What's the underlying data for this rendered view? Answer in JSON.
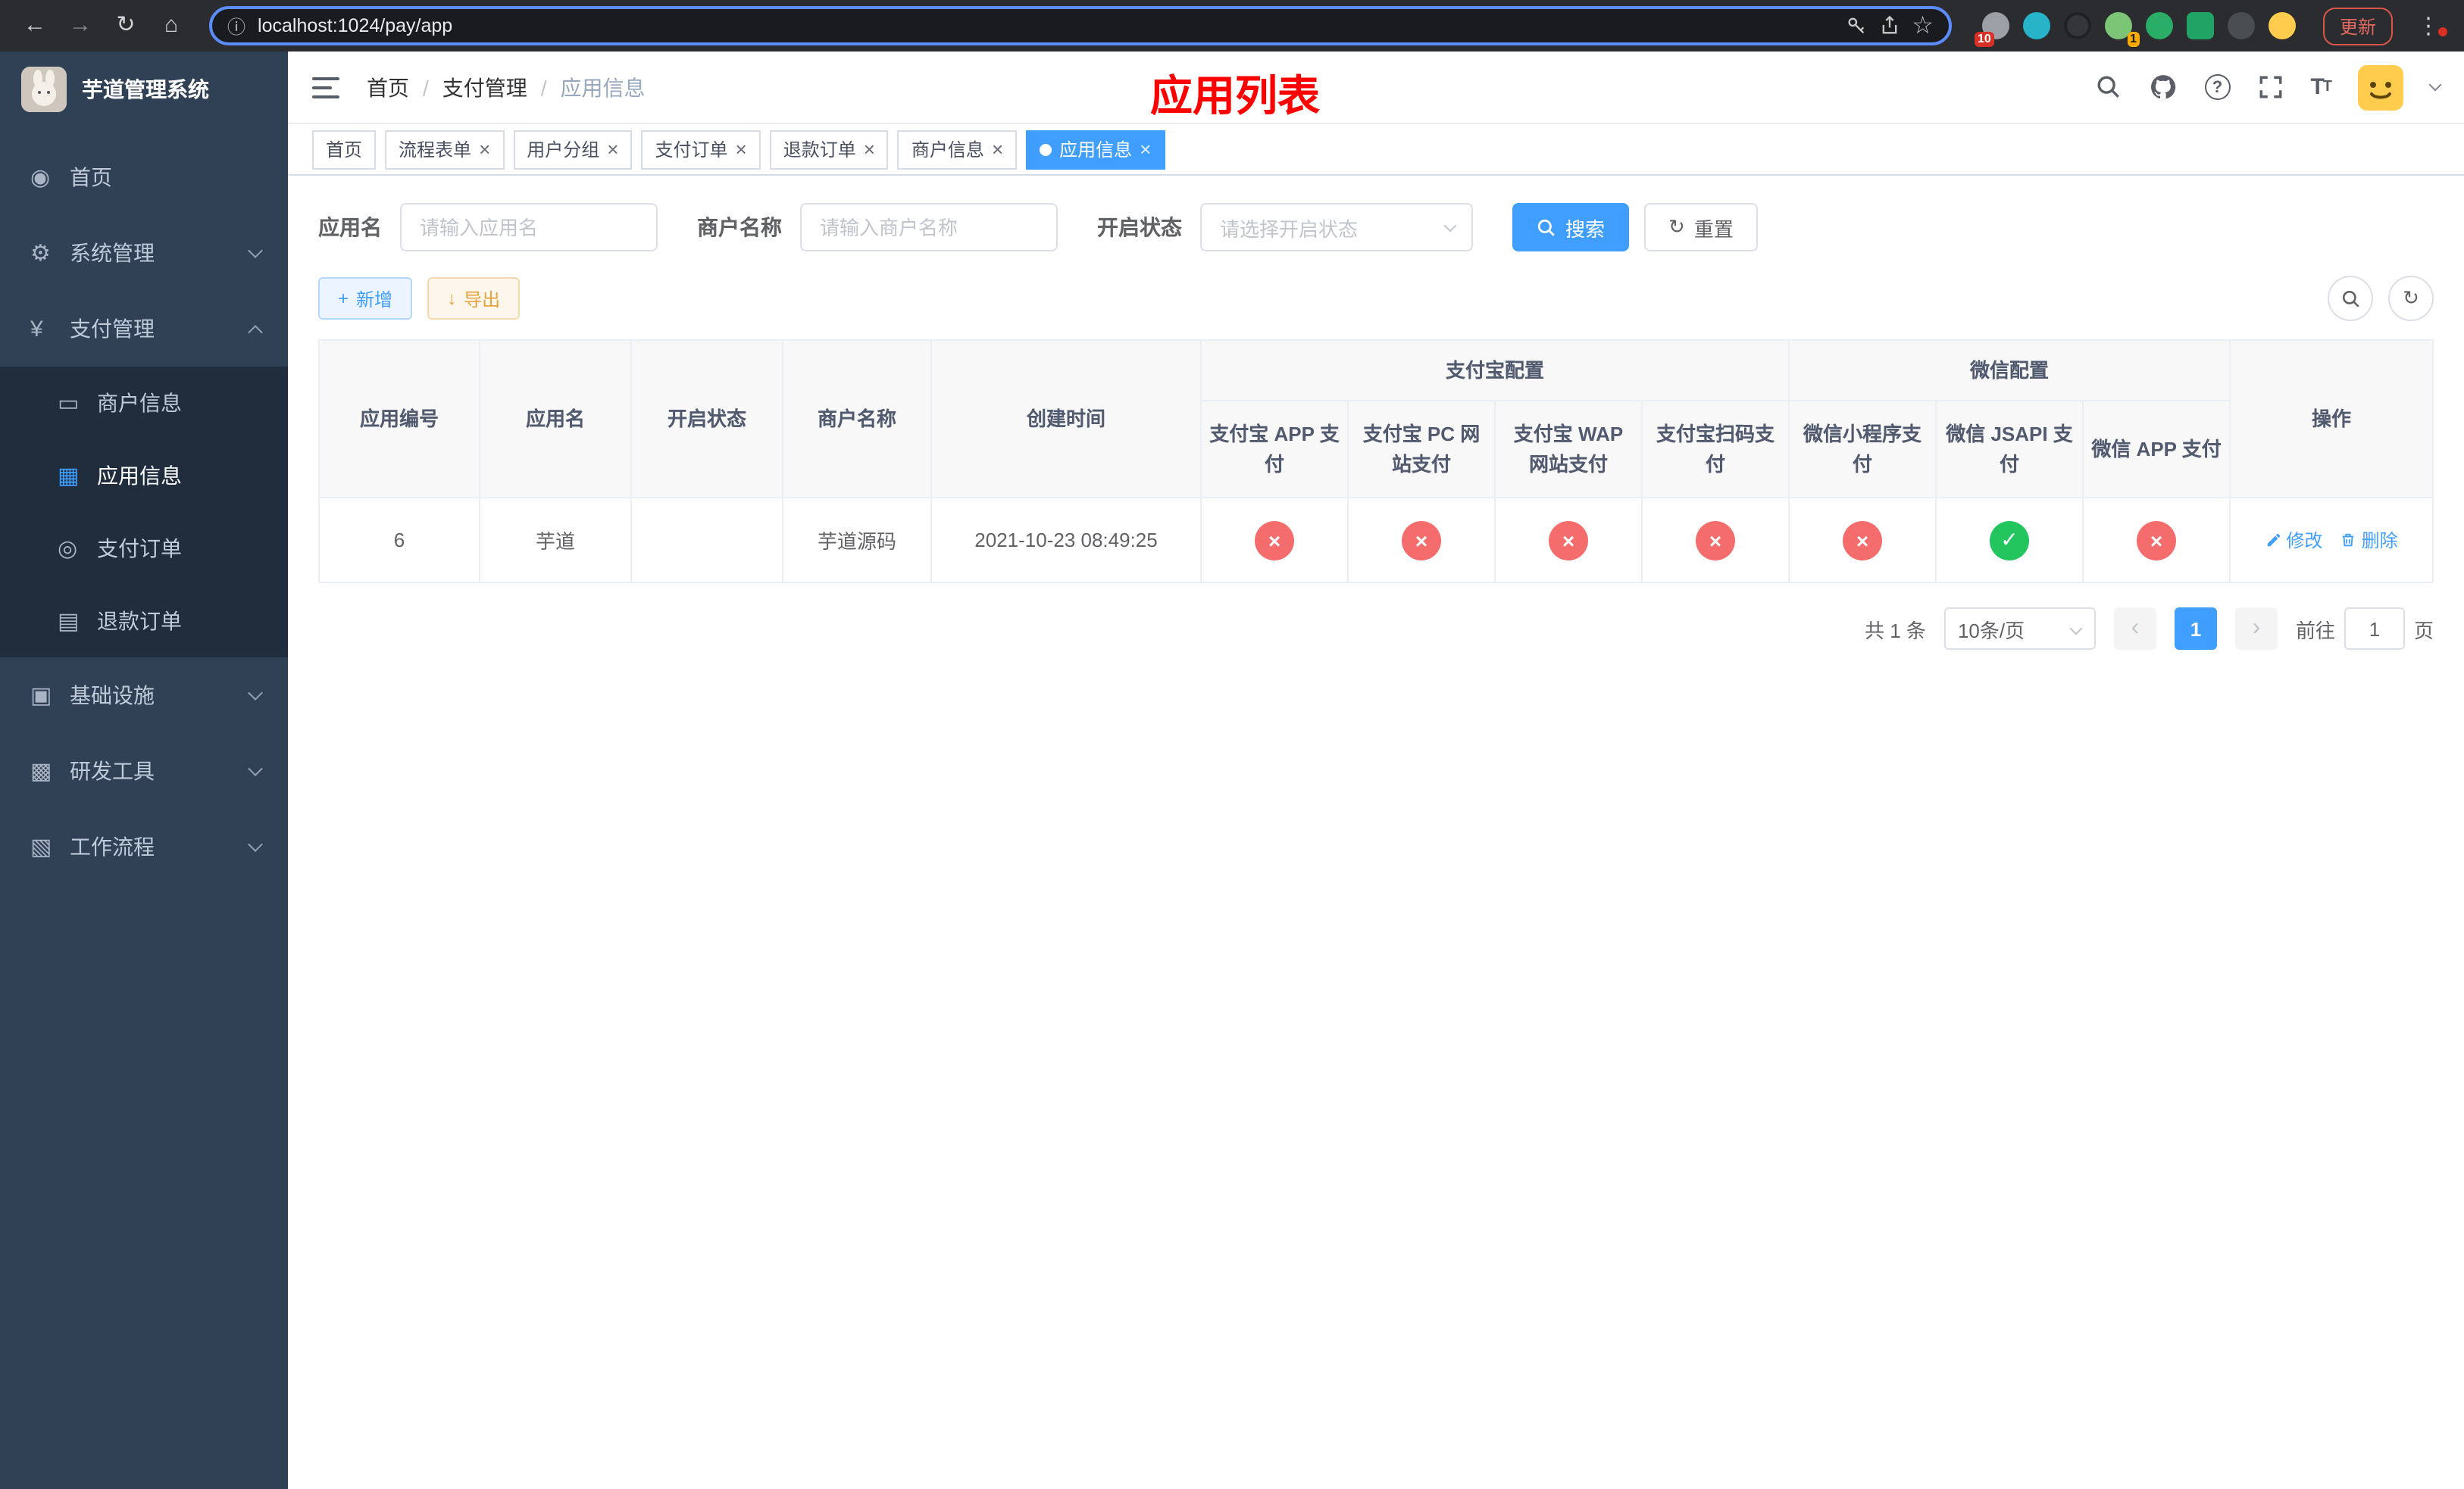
{
  "browser": {
    "url": "localhost:1024/pay/app",
    "update_label": "更新",
    "ext_badge_1": "10",
    "ext_badge_2": "1"
  },
  "sidebar": {
    "title": "芋道管理系统",
    "items": [
      {
        "label": "首页"
      },
      {
        "label": "系统管理"
      },
      {
        "label": "支付管理"
      },
      {
        "label": "商户信息"
      },
      {
        "label": "应用信息"
      },
      {
        "label": "支付订单"
      },
      {
        "label": "退款订单"
      },
      {
        "label": "基础设施"
      },
      {
        "label": "研发工具"
      },
      {
        "label": "工作流程"
      }
    ]
  },
  "header": {
    "breadcrumb": [
      "首页",
      "支付管理",
      "应用信息"
    ],
    "page_title": "应用列表"
  },
  "tabs": [
    {
      "label": "首页"
    },
    {
      "label": "流程表单"
    },
    {
      "label": "用户分组"
    },
    {
      "label": "支付订单"
    },
    {
      "label": "退款订单"
    },
    {
      "label": "商户信息"
    },
    {
      "label": "应用信息"
    }
  ],
  "filters": {
    "app_name_label": "应用名",
    "app_name_placeholder": "请输入应用名",
    "merchant_label": "商户名称",
    "merchant_placeholder": "请输入商户名称",
    "status_label": "开启状态",
    "status_placeholder": "请选择开启状态",
    "search_label": "搜索",
    "reset_label": "重置"
  },
  "toolbar": {
    "add_label": "新增",
    "export_label": "导出"
  },
  "table": {
    "headers": {
      "app_id": "应用编号",
      "app_name": "应用名",
      "status": "开启状态",
      "merchant": "商户名称",
      "created": "创建时间",
      "alipay_group": "支付宝配置",
      "wechat_group": "微信配置",
      "alipay_app": "支付宝 APP 支付",
      "alipay_pc": "支付宝 PC 网站支付",
      "alipay_wap": "支付宝 WAP 网站支付",
      "alipay_scan": "支付宝扫码支付",
      "wx_mini": "微信小程序支付",
      "wx_jsapi": "微信 JSAPI 支付",
      "wx_app": "微信 APP 支付",
      "actions": "操作"
    },
    "rows": [
      {
        "app_id": "6",
        "app_name": "芋道",
        "enabled": true,
        "merchant": "芋道源码",
        "created": "2021-10-23 08:49:25",
        "alipay_app": false,
        "alipay_pc": false,
        "alipay_wap": false,
        "alipay_scan": false,
        "wx_mini": false,
        "wx_jsapi": true,
        "wx_app": false,
        "edit_label": "修改",
        "delete_label": "删除"
      }
    ]
  },
  "pagination": {
    "total": "共 1 条",
    "page_size": "10条/页",
    "current": "1",
    "goto_label": "前往",
    "goto_value": "1",
    "page_unit": "页"
  },
  "colors": {
    "accent": "#409eff",
    "danger": "#f56c6c",
    "success": "#22c55e",
    "title": "#ff0000"
  }
}
